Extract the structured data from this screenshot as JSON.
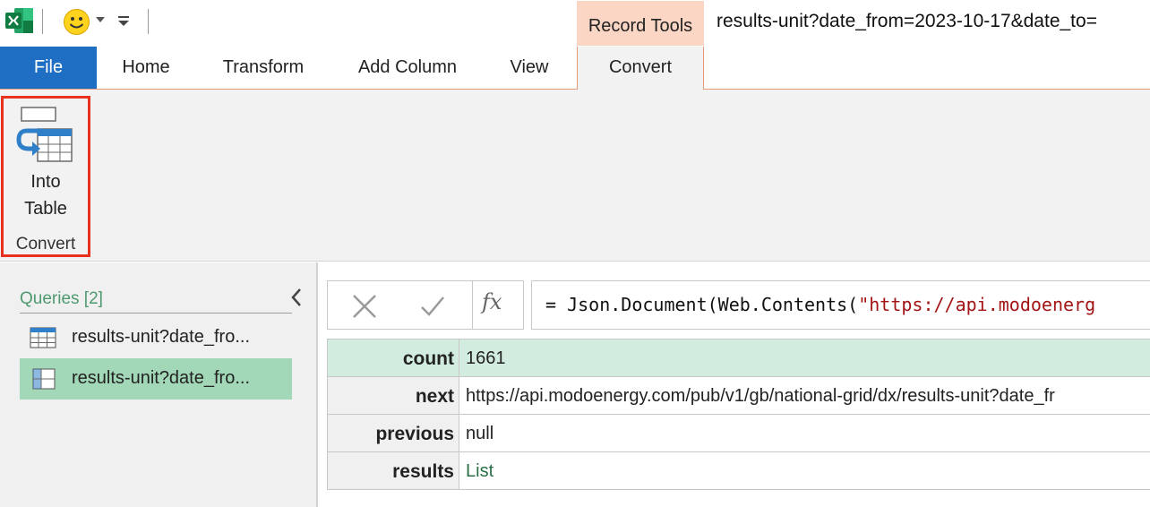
{
  "window": {
    "title": "results-unit?date_from=2023-10-17&date_to="
  },
  "quick_access": {
    "app_icon": "excel-icon",
    "feedback_icon": "smiley-icon"
  },
  "ribbon": {
    "contextual_header": "Record Tools",
    "tabs": {
      "file": "File",
      "home": "Home",
      "transform": "Transform",
      "add_column": "Add Column",
      "view": "View",
      "convert": "Convert"
    },
    "active_tab": "Convert",
    "convert_group": {
      "button_line1": "Into",
      "button_line2": "Table",
      "group_label": "Convert"
    }
  },
  "queries": {
    "header": "Queries [2]",
    "items": [
      {
        "label": "results-unit?date_fro...",
        "selected": false
      },
      {
        "label": "results-unit?date_fro...",
        "selected": true
      }
    ]
  },
  "formula_bar": {
    "fx": "fx",
    "prefix": "= Json.Document(Web.Contents(",
    "string": "\"https://api.modoenerg"
  },
  "record": {
    "rows": [
      {
        "key": "count",
        "value": "1661"
      },
      {
        "key": "next",
        "value": "https://api.modoenergy.com/pub/v1/gb/national-grid/dx/results-unit?date_fr"
      },
      {
        "key": "previous",
        "value": "null"
      },
      {
        "key": "results",
        "value": "List"
      }
    ]
  },
  "colors": {
    "file_tab": "#1e6fc4",
    "contextual": "#fbd6c4",
    "highlight": "#e8311f",
    "selection": "#a2d8b8",
    "link": "#2a6e45"
  }
}
